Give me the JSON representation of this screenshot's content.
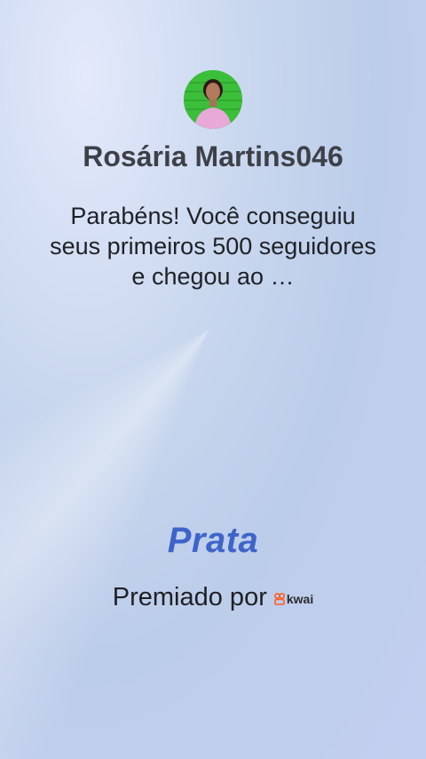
{
  "profile": {
    "username": "Rosária Martins046"
  },
  "message": {
    "text": "Parabéns! Você conseguiu seus primeiros 500 seguidores e chegou ao …"
  },
  "badge": {
    "tier": "Prata"
  },
  "award": {
    "label": "Premiado por",
    "brand": "kwai"
  },
  "colors": {
    "tier_color": "#3f64c9",
    "brand_color": "#ff5a1f"
  }
}
